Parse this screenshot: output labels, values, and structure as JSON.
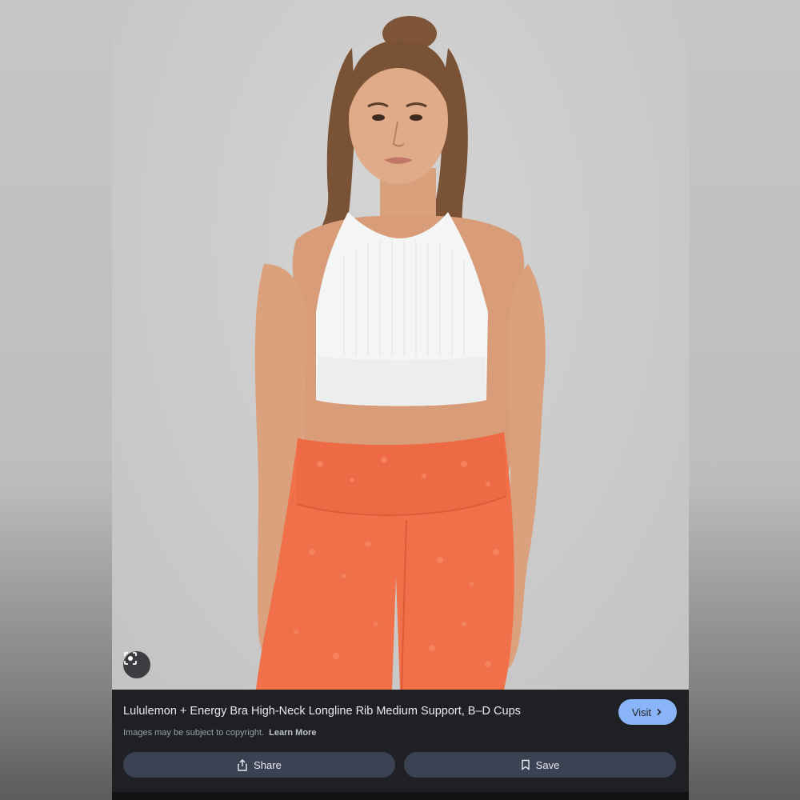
{
  "result": {
    "title": "Lululemon + Energy Bra High-Neck Longline Rib Medium Support, B–D Cups",
    "copyright_notice": "Images may be subject to copyright.",
    "learn_more_label": "Learn More",
    "visit_label": "Visit",
    "share_label": "Share",
    "save_label": "Save"
  },
  "icons": {
    "lens": "image-search-icon",
    "visit": "chevron-right-icon",
    "share": "share-icon",
    "save": "bookmark-icon"
  },
  "colors": {
    "panel_background": "#1f2023",
    "visit_button": "#8ab4f8",
    "action_button": "#3b4253",
    "leggings": "#f0704a",
    "top": "#f4f5f5"
  }
}
